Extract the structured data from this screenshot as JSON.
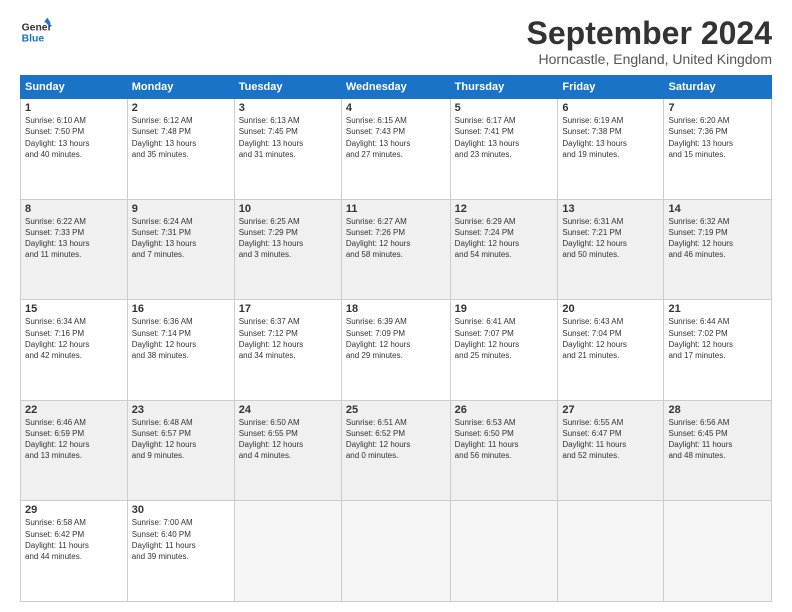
{
  "header": {
    "logo_line1": "General",
    "logo_line2": "Blue",
    "month_title": "September 2024",
    "subtitle": "Horncastle, England, United Kingdom"
  },
  "weekdays": [
    "Sunday",
    "Monday",
    "Tuesday",
    "Wednesday",
    "Thursday",
    "Friday",
    "Saturday"
  ],
  "weeks": [
    [
      {
        "day": "1",
        "info": "Sunrise: 6:10 AM\nSunset: 7:50 PM\nDaylight: 13 hours\nand 40 minutes."
      },
      {
        "day": "2",
        "info": "Sunrise: 6:12 AM\nSunset: 7:48 PM\nDaylight: 13 hours\nand 35 minutes."
      },
      {
        "day": "3",
        "info": "Sunrise: 6:13 AM\nSunset: 7:45 PM\nDaylight: 13 hours\nand 31 minutes."
      },
      {
        "day": "4",
        "info": "Sunrise: 6:15 AM\nSunset: 7:43 PM\nDaylight: 13 hours\nand 27 minutes."
      },
      {
        "day": "5",
        "info": "Sunrise: 6:17 AM\nSunset: 7:41 PM\nDaylight: 13 hours\nand 23 minutes."
      },
      {
        "day": "6",
        "info": "Sunrise: 6:19 AM\nSunset: 7:38 PM\nDaylight: 13 hours\nand 19 minutes."
      },
      {
        "day": "7",
        "info": "Sunrise: 6:20 AM\nSunset: 7:36 PM\nDaylight: 13 hours\nand 15 minutes."
      }
    ],
    [
      {
        "day": "8",
        "info": "Sunrise: 6:22 AM\nSunset: 7:33 PM\nDaylight: 13 hours\nand 11 minutes."
      },
      {
        "day": "9",
        "info": "Sunrise: 6:24 AM\nSunset: 7:31 PM\nDaylight: 13 hours\nand 7 minutes."
      },
      {
        "day": "10",
        "info": "Sunrise: 6:25 AM\nSunset: 7:29 PM\nDaylight: 13 hours\nand 3 minutes."
      },
      {
        "day": "11",
        "info": "Sunrise: 6:27 AM\nSunset: 7:26 PM\nDaylight: 12 hours\nand 58 minutes."
      },
      {
        "day": "12",
        "info": "Sunrise: 6:29 AM\nSunset: 7:24 PM\nDaylight: 12 hours\nand 54 minutes."
      },
      {
        "day": "13",
        "info": "Sunrise: 6:31 AM\nSunset: 7:21 PM\nDaylight: 12 hours\nand 50 minutes."
      },
      {
        "day": "14",
        "info": "Sunrise: 6:32 AM\nSunset: 7:19 PM\nDaylight: 12 hours\nand 46 minutes."
      }
    ],
    [
      {
        "day": "15",
        "info": "Sunrise: 6:34 AM\nSunset: 7:16 PM\nDaylight: 12 hours\nand 42 minutes."
      },
      {
        "day": "16",
        "info": "Sunrise: 6:36 AM\nSunset: 7:14 PM\nDaylight: 12 hours\nand 38 minutes."
      },
      {
        "day": "17",
        "info": "Sunrise: 6:37 AM\nSunset: 7:12 PM\nDaylight: 12 hours\nand 34 minutes."
      },
      {
        "day": "18",
        "info": "Sunrise: 6:39 AM\nSunset: 7:09 PM\nDaylight: 12 hours\nand 29 minutes."
      },
      {
        "day": "19",
        "info": "Sunrise: 6:41 AM\nSunset: 7:07 PM\nDaylight: 12 hours\nand 25 minutes."
      },
      {
        "day": "20",
        "info": "Sunrise: 6:43 AM\nSunset: 7:04 PM\nDaylight: 12 hours\nand 21 minutes."
      },
      {
        "day": "21",
        "info": "Sunrise: 6:44 AM\nSunset: 7:02 PM\nDaylight: 12 hours\nand 17 minutes."
      }
    ],
    [
      {
        "day": "22",
        "info": "Sunrise: 6:46 AM\nSunset: 6:59 PM\nDaylight: 12 hours\nand 13 minutes."
      },
      {
        "day": "23",
        "info": "Sunrise: 6:48 AM\nSunset: 6:57 PM\nDaylight: 12 hours\nand 9 minutes."
      },
      {
        "day": "24",
        "info": "Sunrise: 6:50 AM\nSunset: 6:55 PM\nDaylight: 12 hours\nand 4 minutes."
      },
      {
        "day": "25",
        "info": "Sunrise: 6:51 AM\nSunset: 6:52 PM\nDaylight: 12 hours\nand 0 minutes."
      },
      {
        "day": "26",
        "info": "Sunrise: 6:53 AM\nSunset: 6:50 PM\nDaylight: 11 hours\nand 56 minutes."
      },
      {
        "day": "27",
        "info": "Sunrise: 6:55 AM\nSunset: 6:47 PM\nDaylight: 11 hours\nand 52 minutes."
      },
      {
        "day": "28",
        "info": "Sunrise: 6:56 AM\nSunset: 6:45 PM\nDaylight: 11 hours\nand 48 minutes."
      }
    ],
    [
      {
        "day": "29",
        "info": "Sunrise: 6:58 AM\nSunset: 6:42 PM\nDaylight: 11 hours\nand 44 minutes."
      },
      {
        "day": "30",
        "info": "Sunrise: 7:00 AM\nSunset: 6:40 PM\nDaylight: 11 hours\nand 39 minutes."
      },
      null,
      null,
      null,
      null,
      null
    ]
  ]
}
